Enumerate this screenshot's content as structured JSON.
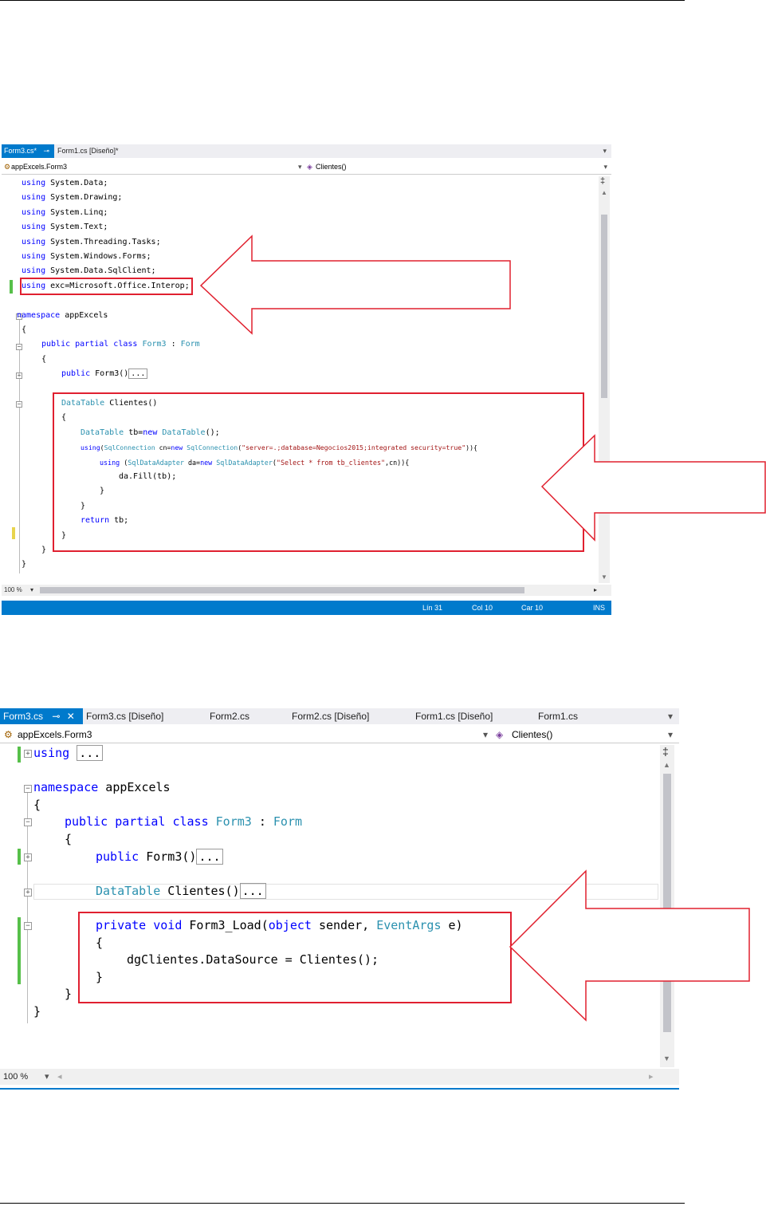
{
  "screenshot1": {
    "tabs": [
      {
        "label": "Form3.cs*",
        "active": true
      },
      {
        "label": "Form1.cs [Diseño]*",
        "active": false
      }
    ],
    "pin_icon": "pin-icon",
    "close_icon": "close-icon",
    "nav_left": "appExcels.Form3",
    "nav_right": "Clientes()",
    "code_lines": [
      {
        "kw": "using",
        "rest": " System.Data;"
      },
      {
        "kw": "using",
        "rest": " System.Drawing;"
      },
      {
        "kw": "using",
        "rest": " System.Linq;"
      },
      {
        "kw": "using",
        "rest": " System.Text;"
      },
      {
        "kw": "using",
        "rest": " System.Threading.Tasks;"
      },
      {
        "kw": "using",
        "rest": " System.Windows.Forms;"
      },
      {
        "kw": "using",
        "rest": " System.Data.SqlClient;"
      },
      {
        "kw": "using",
        "rest": " exc=Microsoft.Office.Interop;"
      }
    ],
    "namespace_kw": "namespace",
    "namespace_name": " appExcels",
    "open_brace": "{",
    "close_brace": "}",
    "class_kw": "public partial class",
    "class_name": "Form3",
    "class_sep": " : ",
    "class_base": "Form",
    "ctor_kw": "public",
    "ctor_name": " Form3()",
    "collapsed": "...",
    "method_type": "DataTable",
    "method_name": " Clientes()",
    "m_l1_type": "DataTable",
    "m_l1_mid": " tb=",
    "m_l1_new": "new",
    "m_l1_type2": "DataTable",
    "m_l1_end": "();",
    "m_l2_kw": "using",
    "m_l2_open": "(",
    "m_l2_type": "SqlConnection",
    "m_l2_mid": " cn=",
    "m_l2_new": "new",
    "m_l2_type2": "SqlConnection",
    "m_l2_str": "\"server=.;database=Negocios2015;integrated security=true\"",
    "m_l2_end": ")){",
    "m_l3_kw": "using",
    "m_l3_open": " (",
    "m_l3_type": "SqlDataAdapter",
    "m_l3_mid": " da=",
    "m_l3_new": "new",
    "m_l3_type2": "SqlDataAdapter",
    "m_l3_str": "\"Select * from tb_clientes\"",
    "m_l3_end": ",cn)){",
    "m_l4": "da.Fill(tb);",
    "m_ret_kw": "return",
    "m_ret_rest": " tb;",
    "zoom": "100 %",
    "status": {
      "ln": "Lín 31",
      "col": "Col 10",
      "car": "Car 10",
      "ins": "INS"
    }
  },
  "screenshot2": {
    "tabs": [
      {
        "label": "Form3.cs",
        "active": true
      },
      {
        "label": "Form3.cs [Diseño]",
        "active": false
      },
      {
        "label": "Form2.cs",
        "active": false
      },
      {
        "label": "Form2.cs [Diseño]",
        "active": false
      },
      {
        "label": "Form1.cs [Diseño]",
        "active": false
      },
      {
        "label": "Form1.cs",
        "active": false
      }
    ],
    "pin_icon": "pin-icon",
    "close_icon": "close-icon",
    "nav_left": "appExcels.Form3",
    "nav_right": "Clientes()",
    "using_kw": "using",
    "collapsed": "...",
    "namespace_kw": "namespace",
    "namespace_name": " appExcels",
    "open_brace": "{",
    "close_brace": "}",
    "class_kw": "public partial class",
    "class_name": "Form3",
    "class_sep": " : ",
    "class_base": "Form",
    "ctor_kw": "public",
    "ctor_name": " Form3()",
    "m1_type": "DataTable",
    "m1_name": " Clientes()",
    "load_kw": "private void",
    "load_name": " Form3_Load(",
    "load_obj": "object",
    "load_sender": " sender, ",
    "load_args": "EventArgs",
    "load_end": " e)",
    "body": "dgClientes.DataSource = Clientes();",
    "zoom": "100 %"
  },
  "colors": {
    "accent": "#007acc",
    "highlight_box": "#e02030",
    "keyword": "#0000ff",
    "type": "#2b91af",
    "string": "#a31515"
  }
}
